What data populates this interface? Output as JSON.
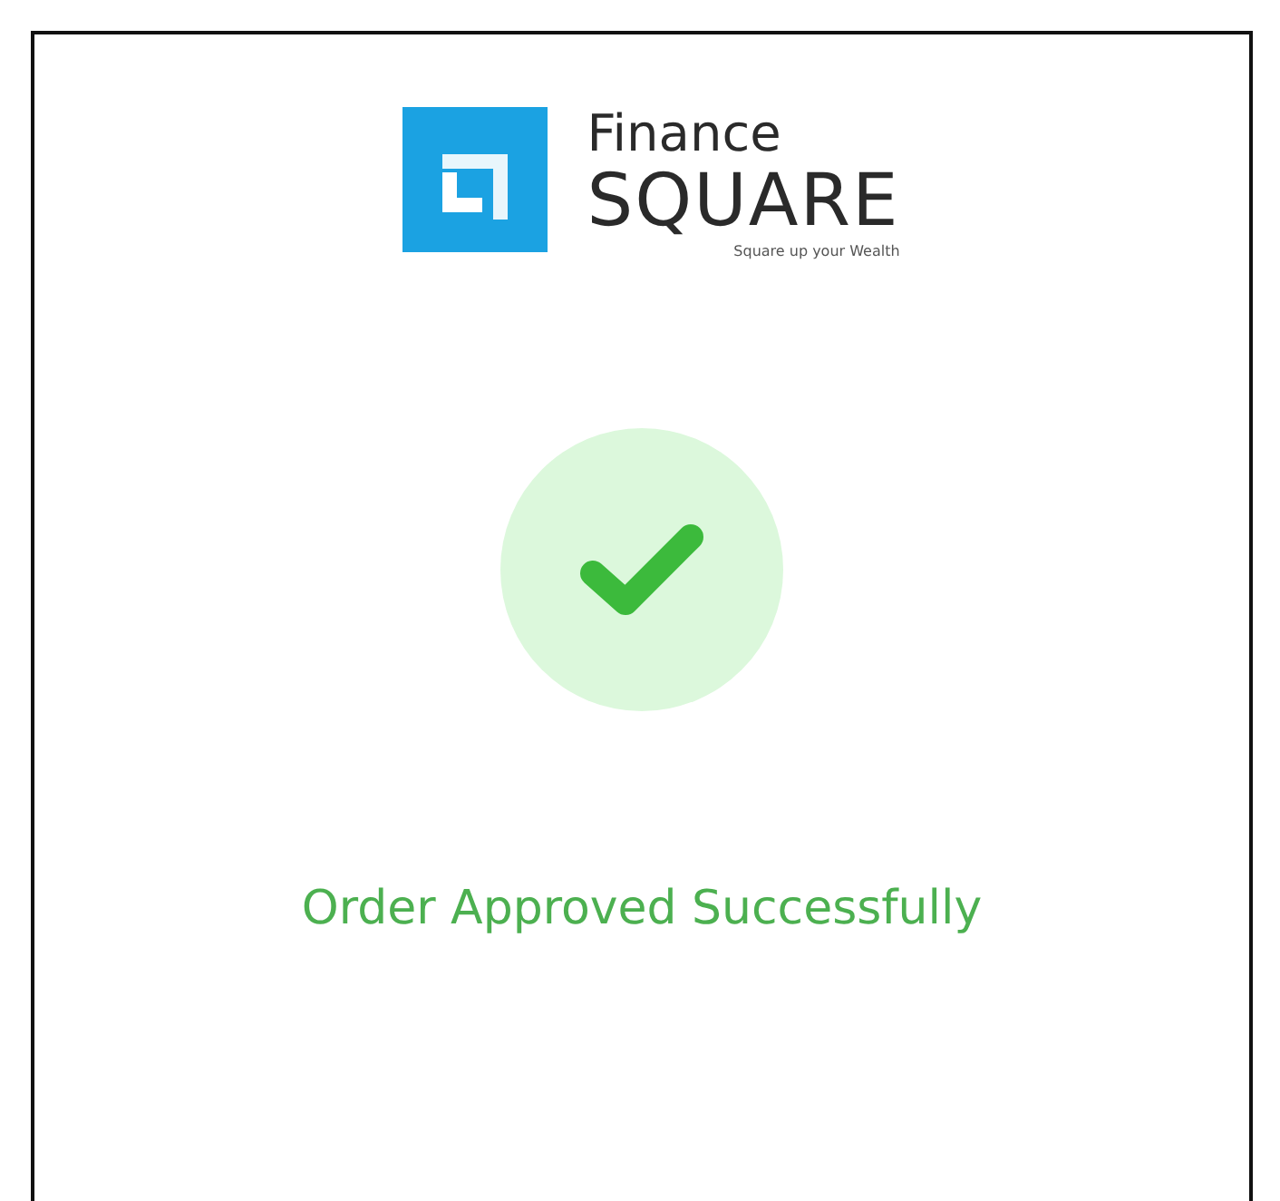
{
  "logo": {
    "line1": "Finance",
    "line2": "SQUARE",
    "tagline": "Square up your Wealth"
  },
  "status": {
    "kind": "success",
    "message": "Order Approved Successfully"
  }
}
